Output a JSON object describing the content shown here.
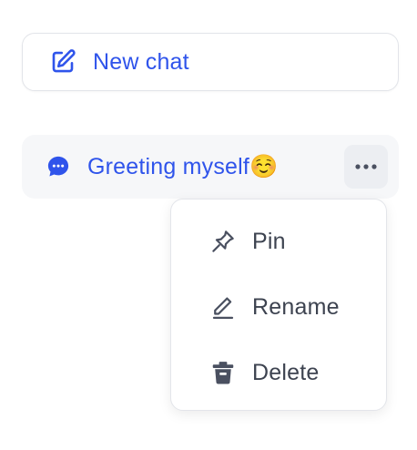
{
  "new_chat": {
    "label": "New chat",
    "icon": "edit-icon"
  },
  "chat_list": [
    {
      "title": "Greeting myself☺️",
      "icon": "chat-bubble-icon",
      "more_icon": "ellipsis-icon"
    }
  ],
  "context_menu": {
    "items": [
      {
        "label": "Pin",
        "icon": "pin-icon"
      },
      {
        "label": "Rename",
        "icon": "pencil-icon"
      },
      {
        "label": "Delete",
        "icon": "trash-icon"
      }
    ]
  },
  "colors": {
    "accent": "#2f54eb",
    "text": "#3d4350",
    "item_background": "#f6f7f9",
    "more_button_background": "#eceef2",
    "border": "#e2e4e9"
  }
}
